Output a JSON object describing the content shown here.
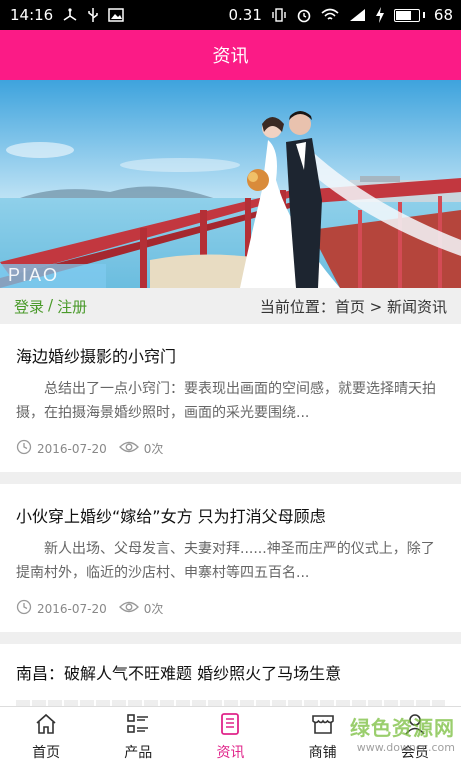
{
  "status_bar": {
    "time": "14:16",
    "battery_percent": "0.31",
    "battery_level": "68",
    "network": "4G"
  },
  "header": {
    "title": "资讯"
  },
  "banner": {
    "logo_text": "PIAO"
  },
  "location_bar": {
    "login": "登录",
    "separator": "/",
    "register": "注册",
    "breadcrumb": "当前位置：首页 > 新闻资讯"
  },
  "articles": [
    {
      "title": "海边婚纱摄影的小窍门",
      "summary": "总结出了一点小窍门：要表现出画面的空间感，就要选择晴天拍摄，在拍摄海景婚纱照时，画面的采光要围绕...",
      "date": "2016-07-20",
      "views": "0次"
    },
    {
      "title": "小伙穿上婚纱“嫁给”女方 只为打消父母顾虑",
      "summary": "新人出场、父母发言、夫妻对拜......神圣而庄严的仪式上，除了提南村外，临近的沙店村、申寨村等四五百名...",
      "date": "2016-07-20",
      "views": "0次"
    },
    {
      "title": "南昌：破解人气不旺难题 婚纱照火了马场生意",
      "summary": "",
      "date": "",
      "views": ""
    }
  ],
  "bottom_nav": {
    "items": [
      {
        "label": "首页",
        "icon": "home-icon"
      },
      {
        "label": "产品",
        "icon": "grid-list-icon"
      },
      {
        "label": "资讯",
        "icon": "document-icon",
        "active": true
      },
      {
        "label": "商铺",
        "icon": "store-icon"
      },
      {
        "label": "会员",
        "icon": "user-icon"
      }
    ]
  },
  "watermark": {
    "main": "绿色资源网",
    "sub": "www.downcc.com"
  },
  "colors": {
    "brand": "#fb1b86",
    "active_tab": "#e0248a",
    "link_green": "#4a9a2a"
  }
}
